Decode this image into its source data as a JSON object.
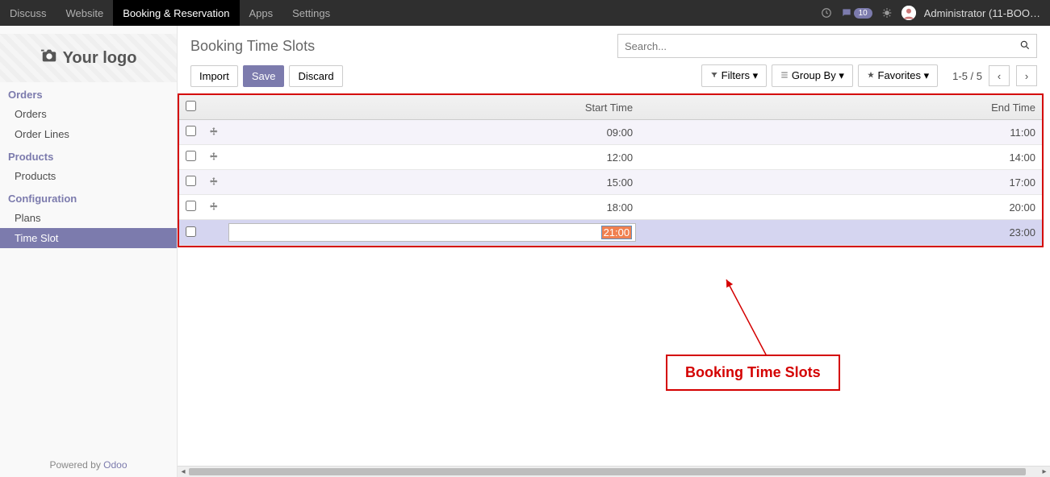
{
  "nav": {
    "items": [
      {
        "label": "Discuss",
        "active": false
      },
      {
        "label": "Website",
        "active": false
      },
      {
        "label": "Booking & Reservation",
        "active": true
      },
      {
        "label": "Apps",
        "active": false
      },
      {
        "label": "Settings",
        "active": false
      }
    ],
    "msg_badge": "10",
    "user": "Administrator (11-BOO…"
  },
  "logo_text": "Your logo",
  "sidebar": {
    "sections": [
      {
        "title": "Orders",
        "items": [
          {
            "label": "Orders",
            "active": false
          },
          {
            "label": "Order Lines",
            "active": false
          }
        ]
      },
      {
        "title": "Products",
        "items": [
          {
            "label": "Products",
            "active": false
          }
        ]
      },
      {
        "title": "Configuration",
        "items": [
          {
            "label": "Plans",
            "active": false
          },
          {
            "label": "Time Slot",
            "active": true
          }
        ]
      }
    ],
    "footer_prefix": "Powered by ",
    "footer_link": "Odoo"
  },
  "page": {
    "title": "Booking Time Slots",
    "buttons": {
      "import": "Import",
      "save": "Save",
      "discard": "Discard"
    },
    "search_placeholder": "Search...",
    "filters_label": "Filters",
    "groupby_label": "Group By",
    "favorites_label": "Favorites",
    "pager": "1-5 / 5"
  },
  "table": {
    "headers": {
      "start": "Start Time",
      "end": "End Time"
    },
    "rows": [
      {
        "start": "09:00",
        "end": "11:00",
        "editing": false,
        "stripe": true
      },
      {
        "start": "12:00",
        "end": "14:00",
        "editing": false,
        "stripe": false
      },
      {
        "start": "15:00",
        "end": "17:00",
        "editing": false,
        "stripe": true
      },
      {
        "start": "18:00",
        "end": "20:00",
        "editing": false,
        "stripe": false
      },
      {
        "start": "21:00",
        "end": "23:00",
        "editing": true,
        "stripe": false
      }
    ]
  },
  "annotation": {
    "text": "Booking Time Slots"
  }
}
